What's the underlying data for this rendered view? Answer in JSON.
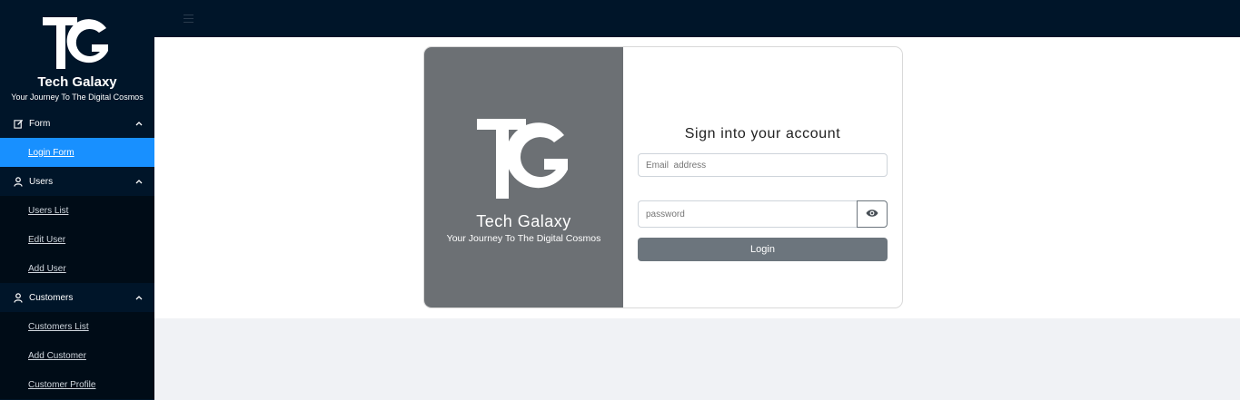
{
  "brand": {
    "logo_text": "TG",
    "title": "Tech Galaxy",
    "subtitle": "Your Journey To The Digital Cosmos"
  },
  "sidebar": {
    "groups": [
      {
        "label": "Form",
        "icon": "edit-icon",
        "expanded": true,
        "items": [
          {
            "label": "Login Form",
            "active": true
          }
        ]
      },
      {
        "label": "Users",
        "icon": "user-icon",
        "expanded": true,
        "items": [
          {
            "label": "Users List"
          },
          {
            "label": "Edit User"
          },
          {
            "label": "Add User"
          }
        ]
      },
      {
        "label": "Customers",
        "icon": "user-icon",
        "expanded": true,
        "items": [
          {
            "label": "Customers List"
          },
          {
            "label": "Add Customer"
          },
          {
            "label": "Customer Profile"
          }
        ]
      }
    ]
  },
  "header": {
    "menu_toggle_icon": "hamburger-icon"
  },
  "login": {
    "panel_logo_text": "TG",
    "panel_title": "Tech Galaxy",
    "panel_subtitle": "Your Journey To The Digital Cosmos",
    "heading": "Sign into your account",
    "email_placeholder": "Email  address",
    "email_value": "",
    "password_placeholder": "password",
    "password_value": "",
    "toggle_icon": "eye-icon",
    "submit_label": "Login"
  },
  "colors": {
    "sidebar_bg": "#001529",
    "submenu_bg": "#000c17",
    "active_item": "#1890ff",
    "panel_bg": "#6c7074",
    "button_bg": "#6c757d",
    "page_bg": "#f0f2f5"
  }
}
